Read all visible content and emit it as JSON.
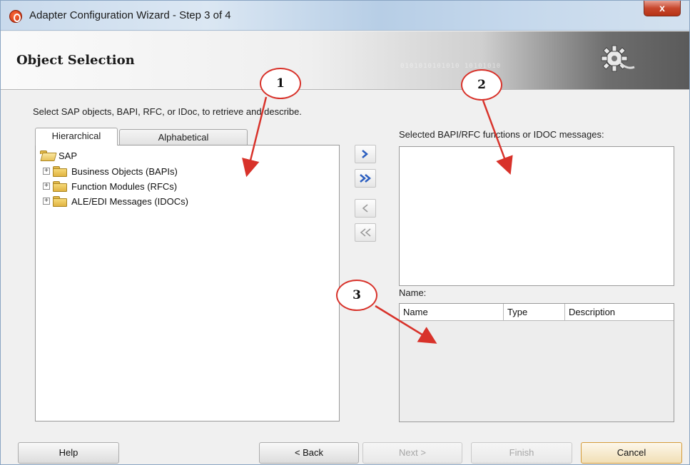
{
  "window": {
    "title": "Adapter Configuration Wizard - Step 3 of 4",
    "close_glyph": "x"
  },
  "header": {
    "title": "Object Selection",
    "binary": "0101010101010 10101010",
    "icon": "gear-plug-icon"
  },
  "instruction": "Select SAP objects, BAPI, RFC, or IDoc, to retrieve and describe.",
  "tabs": [
    {
      "label": "Hierarchical",
      "active": true
    },
    {
      "label": "Alphabetical",
      "active": false
    }
  ],
  "tree": {
    "root": "SAP",
    "items": [
      {
        "label": "Business Objects (BAPIs)",
        "icon": "folder-icon"
      },
      {
        "label": "Function Modules (RFCs)",
        "icon": "folder-icon"
      },
      {
        "label": "ALE/EDI Messages (IDOCs)",
        "icon": "folder-icon"
      }
    ]
  },
  "move_buttons": [
    {
      "icon": "move-right-icon",
      "enabled": true
    },
    {
      "icon": "move-all-right-icon",
      "enabled": true
    },
    {
      "icon": "move-left-icon",
      "enabled": false
    },
    {
      "icon": "move-all-left-icon",
      "enabled": false
    }
  ],
  "selected": {
    "label": "Selected BAPI/RFC functions or IDOC messages:"
  },
  "name_section": {
    "label": "Name:",
    "columns": [
      "Name",
      "Type",
      "Description"
    ]
  },
  "footer": {
    "help": "Help",
    "back": "< Back",
    "next": "Next >",
    "finish": "Finish",
    "cancel": "Cancel"
  },
  "callouts": [
    "1",
    "2",
    "3"
  ],
  "colors": {
    "callout_red": "#d8322a",
    "arrow_blue": "#2c5fc0"
  }
}
